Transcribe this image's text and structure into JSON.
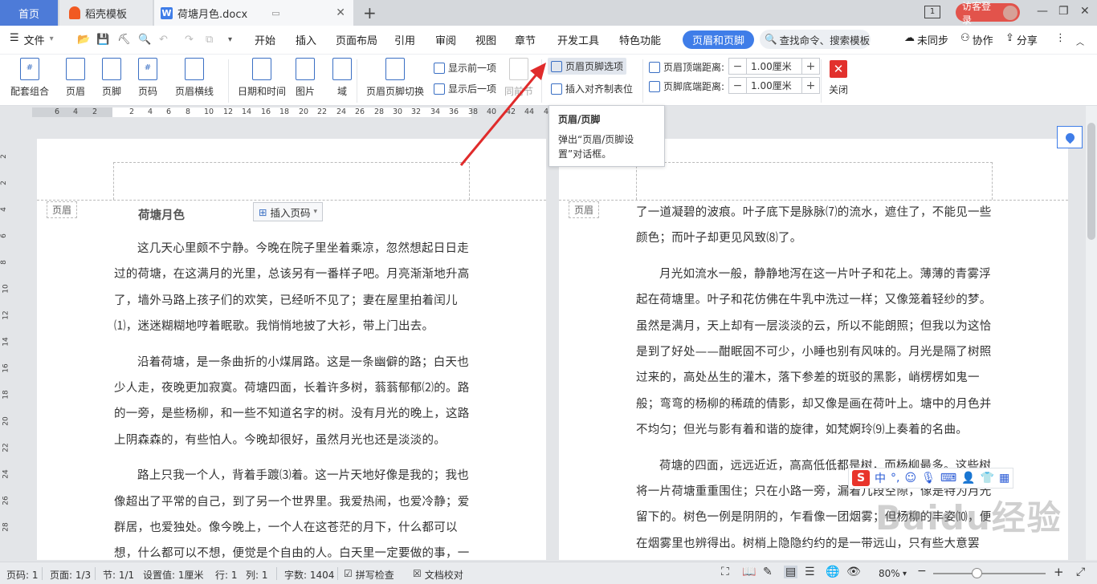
{
  "tabs": {
    "home": "首页",
    "template": "稻壳模板",
    "doc": "荷塘月色.docx",
    "new_tab": "+"
  },
  "account": {
    "login": "访客登录",
    "window_badge": "1"
  },
  "menu": {
    "file": "文件",
    "items": [
      "开始",
      "插入",
      "页面布局",
      "引用",
      "审阅",
      "视图",
      "章节",
      "开发工具",
      "特色功能"
    ],
    "active": "页眉和页脚",
    "search": "查找命令、搜索模板",
    "sync": "未同步",
    "collab": "协作",
    "share": "分享"
  },
  "ribbon": {
    "big": [
      {
        "label": "配套组合",
        "glyph": "#"
      },
      {
        "label": "页眉",
        "glyph": ""
      },
      {
        "label": "页脚",
        "glyph": ""
      },
      {
        "label": "页码",
        "glyph": "#"
      },
      {
        "label": "页眉横线",
        "glyph": ""
      },
      {
        "label": "日期和时间",
        "glyph": ""
      },
      {
        "label": "图片",
        "glyph": ""
      },
      {
        "label": "域",
        "glyph": ""
      },
      {
        "label": "页眉页脚切换",
        "glyph": ""
      }
    ],
    "show_prev": "显示前一项",
    "show_next": "显示后一项",
    "same_prev": "同前节",
    "hf_options": "页眉页脚选项",
    "insert_tab": "插入对齐制表位",
    "header_dist_label": "页眉顶端距离:",
    "header_dist_value": "1.00厘米",
    "footer_dist_label": "页脚底端距离:",
    "footer_dist_value": "1.00厘米",
    "close": "关闭"
  },
  "ruler_numbers": [
    "6",
    "4",
    "2",
    "2",
    "4",
    "6",
    "8",
    "10",
    "12",
    "14",
    "16",
    "18",
    "20",
    "22",
    "24",
    "26",
    "28",
    "30",
    "32",
    "34",
    "36",
    "38",
    "40",
    "42",
    "44",
    "46"
  ],
  "vruler_numbers": [
    "2",
    "2",
    "4",
    "6",
    "8",
    "10",
    "12",
    "14",
    "16",
    "18",
    "20",
    "22",
    "24",
    "26",
    "28"
  ],
  "tooltip": {
    "title": "页眉/页脚",
    "desc": "弹出“页眉/页脚设置”对话框。"
  },
  "page1": {
    "header_tag": "页眉",
    "title": "荷塘月色",
    "insert_page_number": "插入页码",
    "paragraphs": [
      "这几天心里颇不宁静。今晚在院子里坐着乘凉，忽然想起日日走过的荷塘，在这满月的光里，总该另有一番样子吧。月亮渐渐地升高了，墙外马路上孩子们的欢笑，已经听不见了；妻在屋里拍着闰儿⑴，迷迷糊糊地哼着眠歌。我悄悄地披了大衫，带上门出去。",
      "沿着荷塘，是一条曲折的小煤屑路。这是一条幽僻的路；白天也少人走，夜晚更加寂寞。荷塘四面，长着许多树，蓊蓊郁郁⑵的。路的一旁，是些杨柳，和一些不知道名字的树。没有月光的晚上，这路上阴森森的，有些怕人。今晚却很好，虽然月光也还是淡淡的。",
      "路上只我一个人，背着手踱⑶着。这一片天地好像是我的；我也像超出了平常的自己，到了另一个世界里。我爱热闹，也爱冷静；爱群居，也爱独处。像今晚上，一个人在这苍茫的月下，什么都可以想，什么都可以不想，便觉是个自由的人。白天里一定要做的事，一定要"
    ]
  },
  "page2": {
    "header_tag": "页眉",
    "paragraphs": [
      "了一道凝碧的波痕。叶子底下是脉脉⑺的流水，遮住了，不能见一些颜色；而叶子却更见风致⑻了。",
      "月光如流水一般，静静地泻在这一片叶子和花上。薄薄的青雾浮起在荷塘里。叶子和花仿佛在牛乳中洗过一样；又像笼着轻纱的梦。虽然是满月，天上却有一层淡淡的云，所以不能朗照；但我以为这恰是到了好处——酣眠固不可少，小睡也别有风味的。月光是隔了树照过来的，高处丛生的灌木，落下参差的斑驳的黑影，峭楞楞如鬼一般；弯弯的杨柳的稀疏的倩影，却又像是画在荷叶上。塘中的月色并不均匀；但光与影有着和谐的旋律，如梵婀玲⑼上奏着的名曲。",
      "荷塘的四面，远远近近，高高低低都是树，而杨柳最多。这些树将一片荷塘重重围住；只在小路一旁，漏着几段空隙，像是特为月光留下的。树色一例是阴阴的，乍看像一团烟雾；但杨柳的丰姿⑽，便在烟雾里也辨得出。树梢上隐隐约约的是一带远山，只有些大意罢了。"
    ]
  },
  "ime": {
    "lang": "中",
    "logo": "S"
  },
  "watermark": "Baidu经验",
  "status": {
    "page_no": "页码: 1",
    "page_of": "页面: 1/3",
    "section": "节: 1/1",
    "setting": "设置值: 1厘米",
    "row": "行: 1",
    "col": "列: 1",
    "words": "字数: 1404",
    "spell": "拼写检查",
    "proof": "文档校对",
    "zoom": "80%"
  }
}
